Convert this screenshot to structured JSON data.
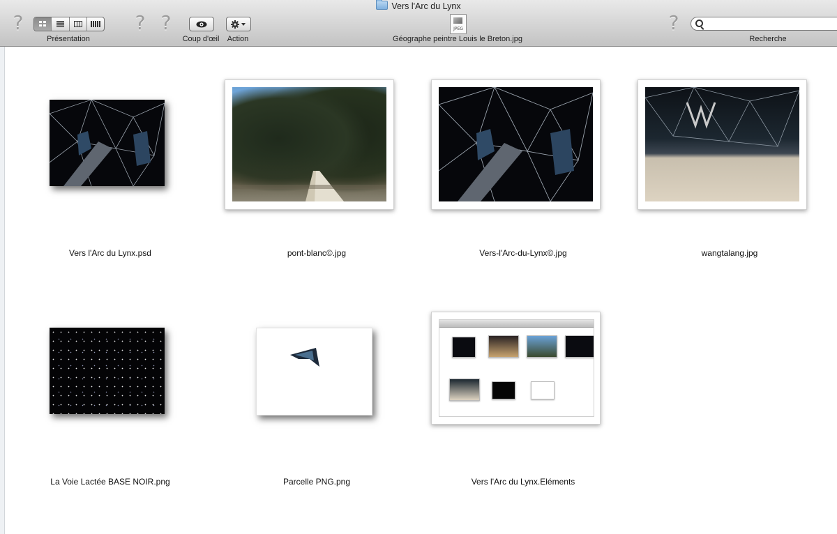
{
  "window": {
    "title": "Vers l'Arc du Lynx",
    "selected_file": "Géographe peintre Louis le Breton.jpg",
    "file_icon_text": "JPEG"
  },
  "toolbar": {
    "presentation_label": "Présentation",
    "quicklook_label": "Coup d'œil",
    "action_label": "Action",
    "search_label": "Recherche",
    "search_value": "",
    "view_modes": [
      "icon-view",
      "list-view",
      "column-view",
      "coverflow-view"
    ],
    "active_view": "icon-view",
    "missing_icon_glyph": "?"
  },
  "files": [
    {
      "name": "Vers l'Arc du Lynx.psd"
    },
    {
      "name": "pont-blanc©.jpg"
    },
    {
      "name": "Vers-l'Arc-du-Lynx©.jpg"
    },
    {
      "name": "wangtalang.jpg"
    },
    {
      "name": "La Voie Lactée BASE NOIR.png"
    },
    {
      "name": "Parcelle PNG.png"
    },
    {
      "name": "Vers l'Arc du Lynx.Eléments"
    }
  ],
  "colors": {
    "toolbar_top": "#e9e9e9",
    "toolbar_bottom": "#c3c3c3",
    "folder_blue": "#7fb0df"
  }
}
